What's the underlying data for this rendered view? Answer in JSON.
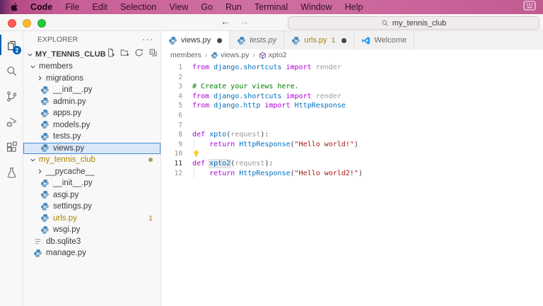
{
  "colors": {
    "accent": "#005FB8",
    "modified": "#AB8300",
    "selection_border": "#3C8CD8",
    "keyword": "#AF00DB",
    "identifier": "#0070C1",
    "menubar_pink": "#CF6FA1"
  },
  "menu_bar": {
    "active_item": "Code",
    "items": [
      "Code",
      "File",
      "Edit",
      "Selection",
      "View",
      "Go",
      "Run",
      "Terminal",
      "Window",
      "Help"
    ]
  },
  "title_bar": {
    "search_value": "my_tennis_club",
    "back_arrow": "←",
    "forward_arrow": "→"
  },
  "activity_bar": {
    "explorer_badge": "2",
    "items": [
      "explorer",
      "search",
      "source-control",
      "run-and-debug",
      "extensions",
      "testing"
    ]
  },
  "explorer": {
    "title": "EXPLORER",
    "ellipsis": "···",
    "section_label": "MY_TENNIS_CLUB",
    "items": [
      {
        "label": "members",
        "type": "folder-open",
        "pad": 8
      },
      {
        "label": "migrations",
        "type": "folder-closed",
        "pad": 18
      },
      {
        "label": "__init__.py",
        "type": "python",
        "pad": 24
      },
      {
        "label": "admin.py",
        "type": "python",
        "pad": 24
      },
      {
        "label": "apps.py",
        "type": "python",
        "pad": 24
      },
      {
        "label": "models.py",
        "type": "python",
        "pad": 24
      },
      {
        "label": "tests.py",
        "type": "python",
        "pad": 24
      },
      {
        "label": "views.py",
        "type": "python",
        "pad": 24,
        "selected": true
      },
      {
        "label": "my_tennis_club",
        "type": "folder-open",
        "pad": 8,
        "modified": true,
        "badge": "dot"
      },
      {
        "label": "__pycache__",
        "type": "folder-closed",
        "pad": 18
      },
      {
        "label": "__init__.py",
        "type": "python",
        "pad": 24
      },
      {
        "label": "asgi.py",
        "type": "python",
        "pad": 24
      },
      {
        "label": "settings.py",
        "type": "python",
        "pad": 24
      },
      {
        "label": "urls.py",
        "type": "python",
        "pad": 24,
        "modified": true,
        "badge": "1"
      },
      {
        "label": "wsgi.py",
        "type": "python",
        "pad": 24
      },
      {
        "label": "db.sqlite3",
        "type": "db",
        "pad": 14
      },
      {
        "label": "manage.py",
        "type": "python",
        "pad": 14
      }
    ]
  },
  "tabs": [
    {
      "label": "views.py",
      "icon": "python",
      "active": true,
      "dirty": true
    },
    {
      "label": "tests.py",
      "icon": "python",
      "preview": true
    },
    {
      "label": "urls.py",
      "icon": "python",
      "modified": true,
      "badge": "1",
      "dirty": true
    },
    {
      "label": "Welcome",
      "icon": "vscode"
    }
  ],
  "breadcrumbs": [
    {
      "label": "members"
    },
    {
      "label": "views.py",
      "icon": "python"
    },
    {
      "label": "xpto2",
      "icon": "method"
    }
  ],
  "editor": {
    "lines": [
      {
        "n": "1",
        "tokens": [
          {
            "t": "from ",
            "c": "kw"
          },
          {
            "t": "django.shortcuts",
            "c": "name"
          },
          {
            "t": " import ",
            "c": "kw"
          },
          {
            "t": "render",
            "c": "unused"
          }
        ]
      },
      {
        "n": "2",
        "tokens": []
      },
      {
        "n": "3",
        "tokens": [
          {
            "t": "# Create your views here.",
            "c": "comment"
          }
        ]
      },
      {
        "n": "4",
        "tokens": [
          {
            "t": "from ",
            "c": "kw"
          },
          {
            "t": "django.shortcuts",
            "c": "name"
          },
          {
            "t": " import ",
            "c": "kw"
          },
          {
            "t": "render",
            "c": "unused"
          }
        ]
      },
      {
        "n": "5",
        "tokens": [
          {
            "t": "from ",
            "c": "kw"
          },
          {
            "t": "django.http",
            "c": "name"
          },
          {
            "t": " import ",
            "c": "kw"
          },
          {
            "t": "HttpResponse",
            "c": "name"
          }
        ]
      },
      {
        "n": "6",
        "tokens": []
      },
      {
        "n": "7",
        "tokens": []
      },
      {
        "n": "8",
        "tokens": [
          {
            "t": "def ",
            "c": "kw"
          },
          {
            "t": "xpto",
            "c": "name"
          },
          {
            "t": "(",
            "c": "plain"
          },
          {
            "t": "request",
            "c": "unused"
          },
          {
            "t": "):",
            "c": "plain"
          }
        ]
      },
      {
        "n": "9",
        "guide": true,
        "tokens": [
          {
            "t": "    ",
            "c": "plain"
          },
          {
            "t": "return ",
            "c": "kw"
          },
          {
            "t": "HttpResponse",
            "c": "name"
          },
          {
            "t": "(",
            "c": "plain"
          },
          {
            "t": "\"Hello world!\"",
            "c": "str"
          },
          {
            "t": ")",
            "c": "plain"
          }
        ]
      },
      {
        "n": "10",
        "bulb": true,
        "tokens": []
      },
      {
        "n": "11",
        "active": true,
        "tokens": [
          {
            "t": "def ",
            "c": "kw"
          },
          {
            "t": "xpto2",
            "c": "name",
            "hl": true
          },
          {
            "t": "(",
            "c": "plain"
          },
          {
            "t": "request",
            "c": "unused"
          },
          {
            "t": "):",
            "c": "plain"
          }
        ]
      },
      {
        "n": "12",
        "guide": true,
        "tokens": [
          {
            "t": "    ",
            "c": "plain"
          },
          {
            "t": "return ",
            "c": "kw"
          },
          {
            "t": "HttpResponse",
            "c": "name"
          },
          {
            "t": "(",
            "c": "plain"
          },
          {
            "t": "\"Hello world2!\"",
            "c": "str"
          },
          {
            "t": ")",
            "c": "plain"
          }
        ]
      }
    ]
  }
}
